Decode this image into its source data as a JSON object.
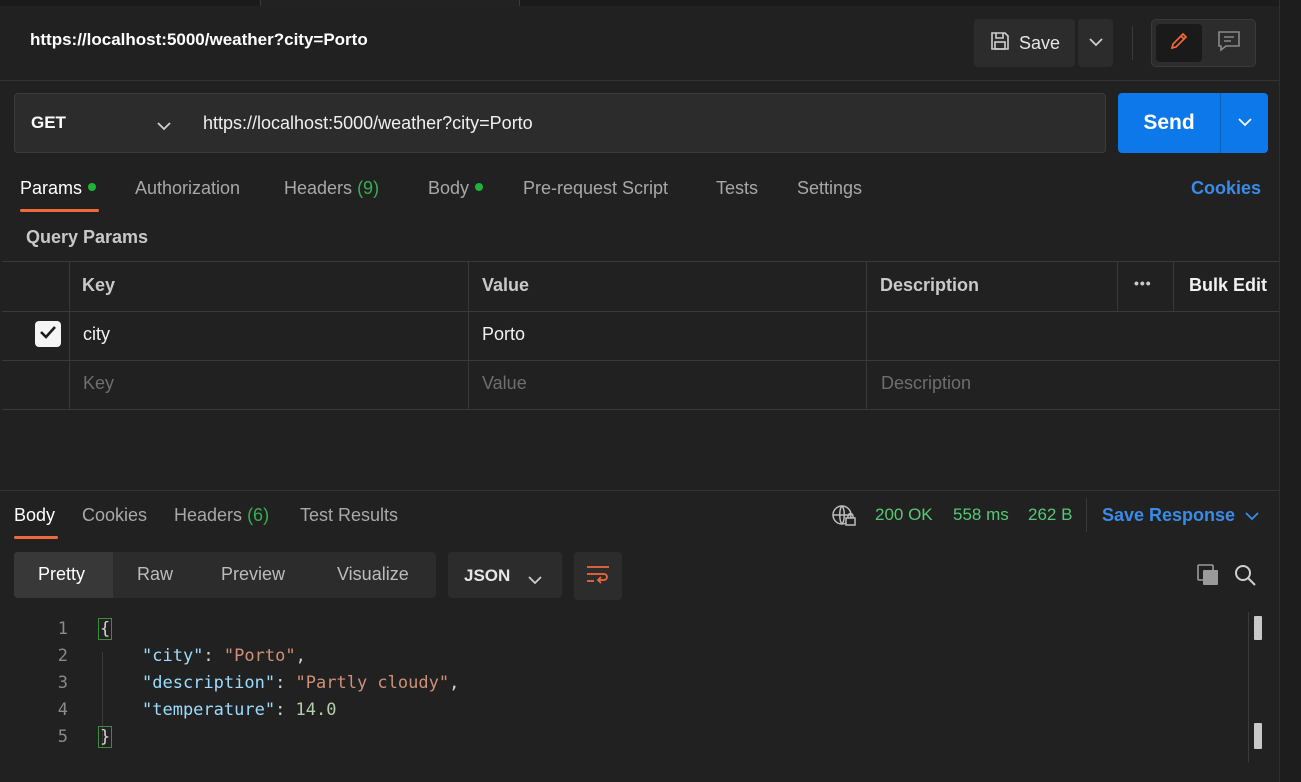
{
  "header": {
    "title": "https://localhost:5000/weather?city=Porto",
    "save_label": "Save"
  },
  "request": {
    "method": "GET",
    "url": "https://localhost:5000/weather?city=Porto",
    "send_label": "Send",
    "tabs": [
      {
        "label": "Params",
        "active": true,
        "dot": true
      },
      {
        "label": "Authorization"
      },
      {
        "label": "Headers",
        "count": "(9)"
      },
      {
        "label": "Body",
        "dot": true
      },
      {
        "label": "Pre-request Script"
      },
      {
        "label": "Tests"
      },
      {
        "label": "Settings"
      }
    ],
    "cookies_label": "Cookies"
  },
  "query_params": {
    "title": "Query Params",
    "columns": {
      "key": "Key",
      "value": "Value",
      "description": "Description",
      "more": "•••",
      "bulk_edit": "Bulk Edit"
    },
    "rows": [
      {
        "checked": true,
        "key": "city",
        "value": "Porto",
        "description": ""
      }
    ],
    "placeholders": {
      "key": "Key",
      "value": "Value",
      "description": "Description"
    }
  },
  "response": {
    "tabs": [
      {
        "label": "Body",
        "active": true
      },
      {
        "label": "Cookies"
      },
      {
        "label": "Headers",
        "count": "(6)"
      },
      {
        "label": "Test Results"
      }
    ],
    "status": "200 OK",
    "time": "558 ms",
    "size": "262 B",
    "save_response_label": "Save Response",
    "view_modes": [
      "Pretty",
      "Raw",
      "Preview",
      "Visualize"
    ],
    "format": "JSON",
    "line_numbers": [
      "1",
      "2",
      "3",
      "4",
      "5"
    ],
    "body": {
      "open_brace": "{",
      "close_brace": "}",
      "fields": [
        {
          "key": "\"city\"",
          "value": "\"Porto\"",
          "comma": ","
        },
        {
          "key": "\"description\"",
          "value": "\"Partly cloudy\"",
          "comma": ","
        },
        {
          "key": "\"temperature\"",
          "value": "14.0",
          "comma": ""
        }
      ]
    }
  },
  "colors": {
    "accent": "#0c78ea",
    "active_tab_underline": "#ef6a3a",
    "status_ok": "#56c874",
    "link": "#3a8be8"
  }
}
